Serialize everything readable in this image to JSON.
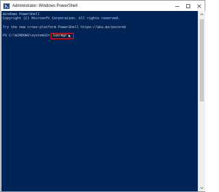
{
  "window": {
    "title": "Administrator: Windows PowerShell"
  },
  "console": {
    "lines": [
      "Windows PowerShell",
      "Copyright (C) Microsoft Corporation. All rights reserved.",
      "Try the new cross-platform PowerShell https://aka.ms/pscore6"
    ],
    "prompt": "PS C:\\WINDOWS\\system32>",
    "command": "lusrmgr"
  },
  "colors": {
    "console_bg": "#012456",
    "highlight_border": "#e01b24"
  },
  "icons": {
    "app": "powershell-icon",
    "minimize": "minimize-icon",
    "maximize": "maximize-icon",
    "close": "close-icon",
    "cursor": "mouse-cursor-icon"
  }
}
